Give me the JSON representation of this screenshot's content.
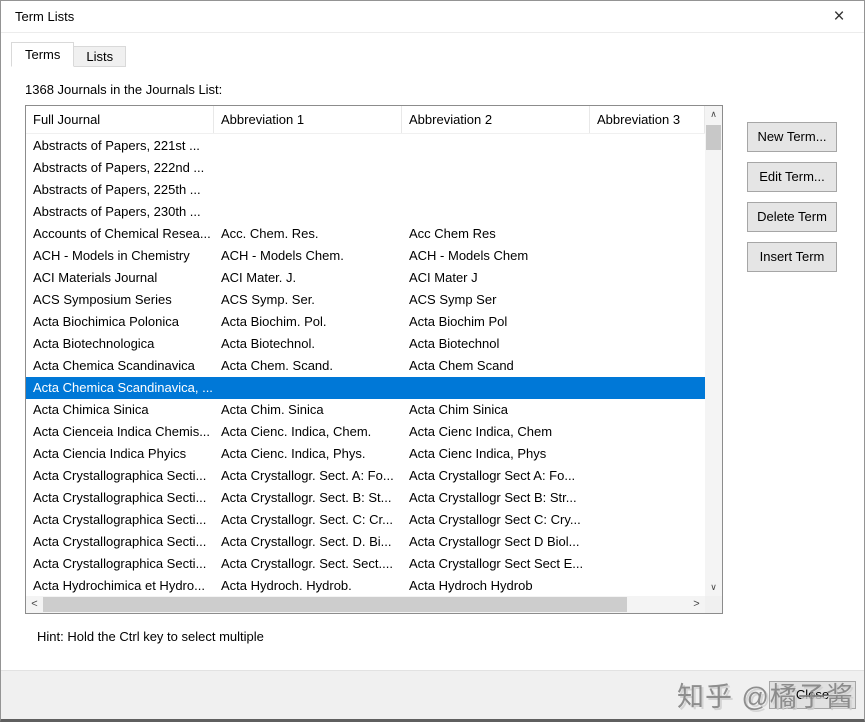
{
  "window": {
    "title": "Term Lists",
    "close_glyph": "×"
  },
  "tabs": [
    {
      "label": "Terms",
      "selected": true
    },
    {
      "label": "Lists",
      "selected": false
    }
  ],
  "list_label": "1368 Journals in the Journals List:",
  "table": {
    "columns": [
      "Full Journal",
      "Abbreviation 1",
      "Abbreviation 2",
      "Abbreviation 3"
    ],
    "selected_index": 11,
    "rows": [
      [
        "Abstracts of Papers, 221st ...",
        "",
        "",
        ""
      ],
      [
        "Abstracts of Papers, 222nd ...",
        "",
        "",
        ""
      ],
      [
        "Abstracts of Papers, 225th ...",
        "",
        "",
        ""
      ],
      [
        "Abstracts of Papers, 230th ...",
        "",
        "",
        ""
      ],
      [
        "Accounts of Chemical Resea...",
        "Acc. Chem. Res.",
        "Acc Chem Res",
        ""
      ],
      [
        "ACH - Models in Chemistry",
        "ACH - Models Chem.",
        "ACH - Models Chem",
        ""
      ],
      [
        "ACI Materials Journal",
        "ACI Mater. J.",
        "ACI Mater J",
        ""
      ],
      [
        "ACS Symposium Series",
        "ACS Symp. Ser.",
        "ACS Symp Ser",
        ""
      ],
      [
        "Acta Biochimica Polonica",
        "Acta Biochim. Pol.",
        "Acta Biochim Pol",
        ""
      ],
      [
        "Acta Biotechnologica",
        "Acta Biotechnol.",
        "Acta Biotechnol",
        ""
      ],
      [
        "Acta Chemica Scandinavica",
        "Acta Chem. Scand.",
        "Acta Chem Scand",
        ""
      ],
      [
        "Acta Chemica Scandinavica, ...",
        "",
        "",
        ""
      ],
      [
        "Acta Chimica Sinica",
        "Acta Chim. Sinica",
        "Acta Chim Sinica",
        ""
      ],
      [
        "Acta Cienceia Indica Chemis...",
        "Acta Cienc. Indica, Chem.",
        "Acta Cienc Indica, Chem",
        ""
      ],
      [
        "Acta Ciencia Indica Phyics",
        "Acta Cienc. Indica, Phys.",
        "Acta Cienc Indica, Phys",
        ""
      ],
      [
        "Acta Crystallographica Secti...",
        "Acta Crystallogr. Sect. A: Fo...",
        "Acta Crystallogr Sect A: Fo...",
        ""
      ],
      [
        "Acta Crystallographica Secti...",
        "Acta Crystallogr. Sect. B: St...",
        "Acta Crystallogr Sect B: Str...",
        ""
      ],
      [
        "Acta Crystallographica Secti...",
        "Acta Crystallogr. Sect. C: Cr...",
        "Acta Crystallogr Sect C: Cry...",
        ""
      ],
      [
        "Acta Crystallographica Secti...",
        "Acta Crystallogr. Sect. D. Bi...",
        "Acta Crystallogr Sect D Biol...",
        ""
      ],
      [
        "Acta Crystallographica Secti...",
        "Acta Crystallogr. Sect. Sect....",
        "Acta Crystallogr Sect Sect E...",
        ""
      ],
      [
        "Acta Hydrochimica et Hydro...",
        "Acta Hydroch. Hydrob.",
        "Acta Hydroch Hydrob",
        ""
      ]
    ]
  },
  "scrollbars": {
    "up_glyph": "∧",
    "down_glyph": "∨",
    "left_glyph": "<",
    "right_glyph": ">"
  },
  "side_buttons": [
    "New Term...",
    "Edit Term...",
    "Delete Term",
    "Insert Term"
  ],
  "hint": "Hint: Hold the Ctrl key to select multiple",
  "footer": {
    "close_label": "Close"
  },
  "watermark": "知乎 @橘子酱",
  "colors": {
    "selection": "#0078d7",
    "window_bg": "#ffffff",
    "footer_bg": "#f0f0f0"
  }
}
